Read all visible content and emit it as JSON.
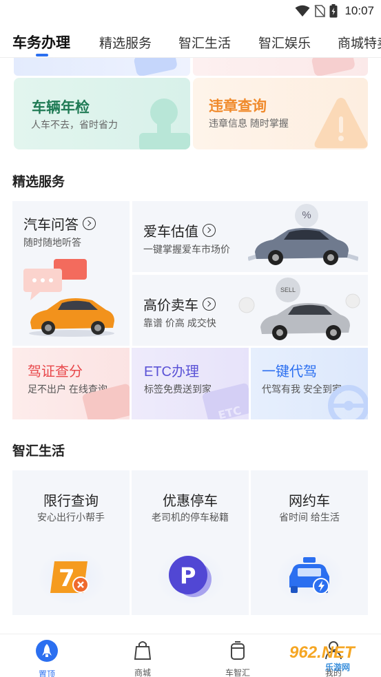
{
  "status_bar": {
    "time": "10:07",
    "icons": [
      "wifi-icon",
      "sim-none-icon",
      "battery-charging-icon"
    ]
  },
  "tabs": [
    {
      "label": "车务办理",
      "active": true
    },
    {
      "label": "精选服务",
      "active": false
    },
    {
      "label": "智汇生活",
      "active": false
    },
    {
      "label": "智汇娱乐",
      "active": false
    },
    {
      "label": "商城特卖",
      "active": false
    }
  ],
  "top_tiles": [
    {
      "title": "车辆年检",
      "subtitle": "人车不去，省时省力",
      "color": "#1f7a54"
    },
    {
      "title": "违章查询",
      "subtitle": "违章信息 随时掌握",
      "color": "#f08a2c"
    }
  ],
  "featured": {
    "section_title": "精选服务",
    "cards": [
      {
        "title": "汽车问答",
        "subtitle": "随时随地听答"
      },
      {
        "title": "爱车估值",
        "subtitle": "一键掌握爱车市场价"
      },
      {
        "title": "高价卖车",
        "subtitle": "靠谱 价高 成交快"
      }
    ],
    "small_cards": [
      {
        "title": "驾证查分",
        "subtitle": "足不出户 在线查询",
        "color": "#e8474a"
      },
      {
        "title": "ETC办理",
        "subtitle": "标签免费送到家",
        "color": "#5a52d6"
      },
      {
        "title": "一键代驾",
        "subtitle": "代驾有我 安全到家",
        "color": "#2b6ff0"
      }
    ],
    "badges": {
      "percent": "%",
      "sell": "SELL",
      "etc": "ETC"
    }
  },
  "life": {
    "section_title": "智汇生活",
    "cards": [
      {
        "title": "限行查询",
        "subtitle": "安心出行小帮手",
        "icon": "traffic-limit-icon",
        "glyph": "7"
      },
      {
        "title": "优惠停车",
        "subtitle": "老司机的停车秘籍",
        "icon": "parking-icon",
        "glyph": "P"
      },
      {
        "title": "网约车",
        "subtitle": "省时间 给生活",
        "icon": "taxi-icon",
        "glyph": ""
      }
    ]
  },
  "bottom_nav": [
    {
      "label": "置顶",
      "icon": "rocket-icon",
      "active": true
    },
    {
      "label": "商城",
      "icon": "shopping-bag-icon",
      "active": false
    },
    {
      "label": "车智汇",
      "icon": "cup-icon",
      "active": false
    },
    {
      "label": "我的",
      "icon": "user-icon",
      "active": false
    }
  ],
  "watermark": {
    "text": "962.NET",
    "sub": "乐游网"
  }
}
